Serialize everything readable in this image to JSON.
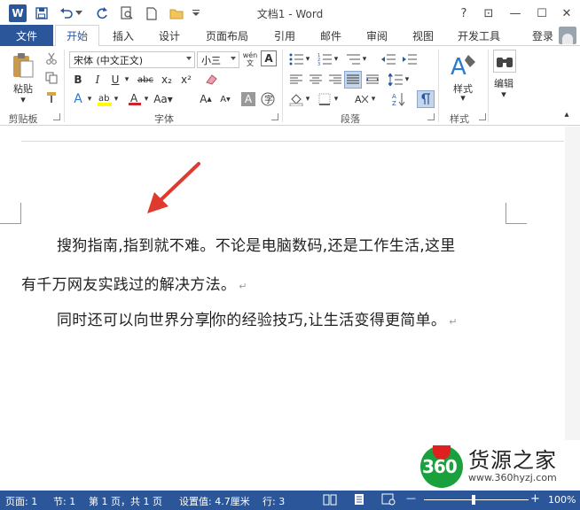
{
  "titlebar": {
    "app_icon": "W",
    "title": "文档1 - Word",
    "qat_icons": [
      "save-icon",
      "undo-icon",
      "redo-icon",
      "print-preview-icon",
      "new-document-icon",
      "open-folder-icon",
      "customize-qat-icon"
    ],
    "help": "?",
    "restore_ribbon": "⊡",
    "minimize": "—",
    "maximize": "☐",
    "close": "✕"
  },
  "tabs": {
    "file": "文件",
    "items": [
      "开始",
      "插入",
      "设计",
      "页面布局",
      "引用",
      "邮件",
      "审阅",
      "视图",
      "开发工具"
    ],
    "active": "开始",
    "login": "登录"
  },
  "ribbon": {
    "clipboard": {
      "label": "剪贴板",
      "paste": "粘贴"
    },
    "font": {
      "label": "字体",
      "font_name": "宋体 (中文正文)",
      "font_size": "小三",
      "wen_label": "wén文",
      "buttons": [
        "B",
        "I",
        "U",
        "abc",
        "x₂",
        "x²"
      ]
    },
    "paragraph": {
      "label": "段落"
    },
    "styles": {
      "label": "样式",
      "button": "样式"
    },
    "editing": {
      "button": "编辑"
    }
  },
  "document": {
    "para1_line1": "搜狗指南,指到就不难。不论是电脑数码,还是工作生活,这里",
    "para1_line2": "有千万网友实践过的解决方法。",
    "para2_before_cursor": "同时还可以向世界分享",
    "para2_after_cursor": "你的经验技巧,让生活变得更简单。",
    "paragraph_mark": "↵"
  },
  "watermark": {
    "badge": "360",
    "title": "货源之家",
    "url": "www.360hyzj.com"
  },
  "statusbar": {
    "page": "页面: 1",
    "section": "节: 1",
    "pages": "第 1 页，共 1 页",
    "position": "设置值: 4.7厘米",
    "line": "行: 3",
    "zoom": "100%"
  },
  "colors": {
    "word_blue": "#2b579a",
    "arrow_red": "#e03a2f",
    "watermark_green": "#1aa03c"
  }
}
